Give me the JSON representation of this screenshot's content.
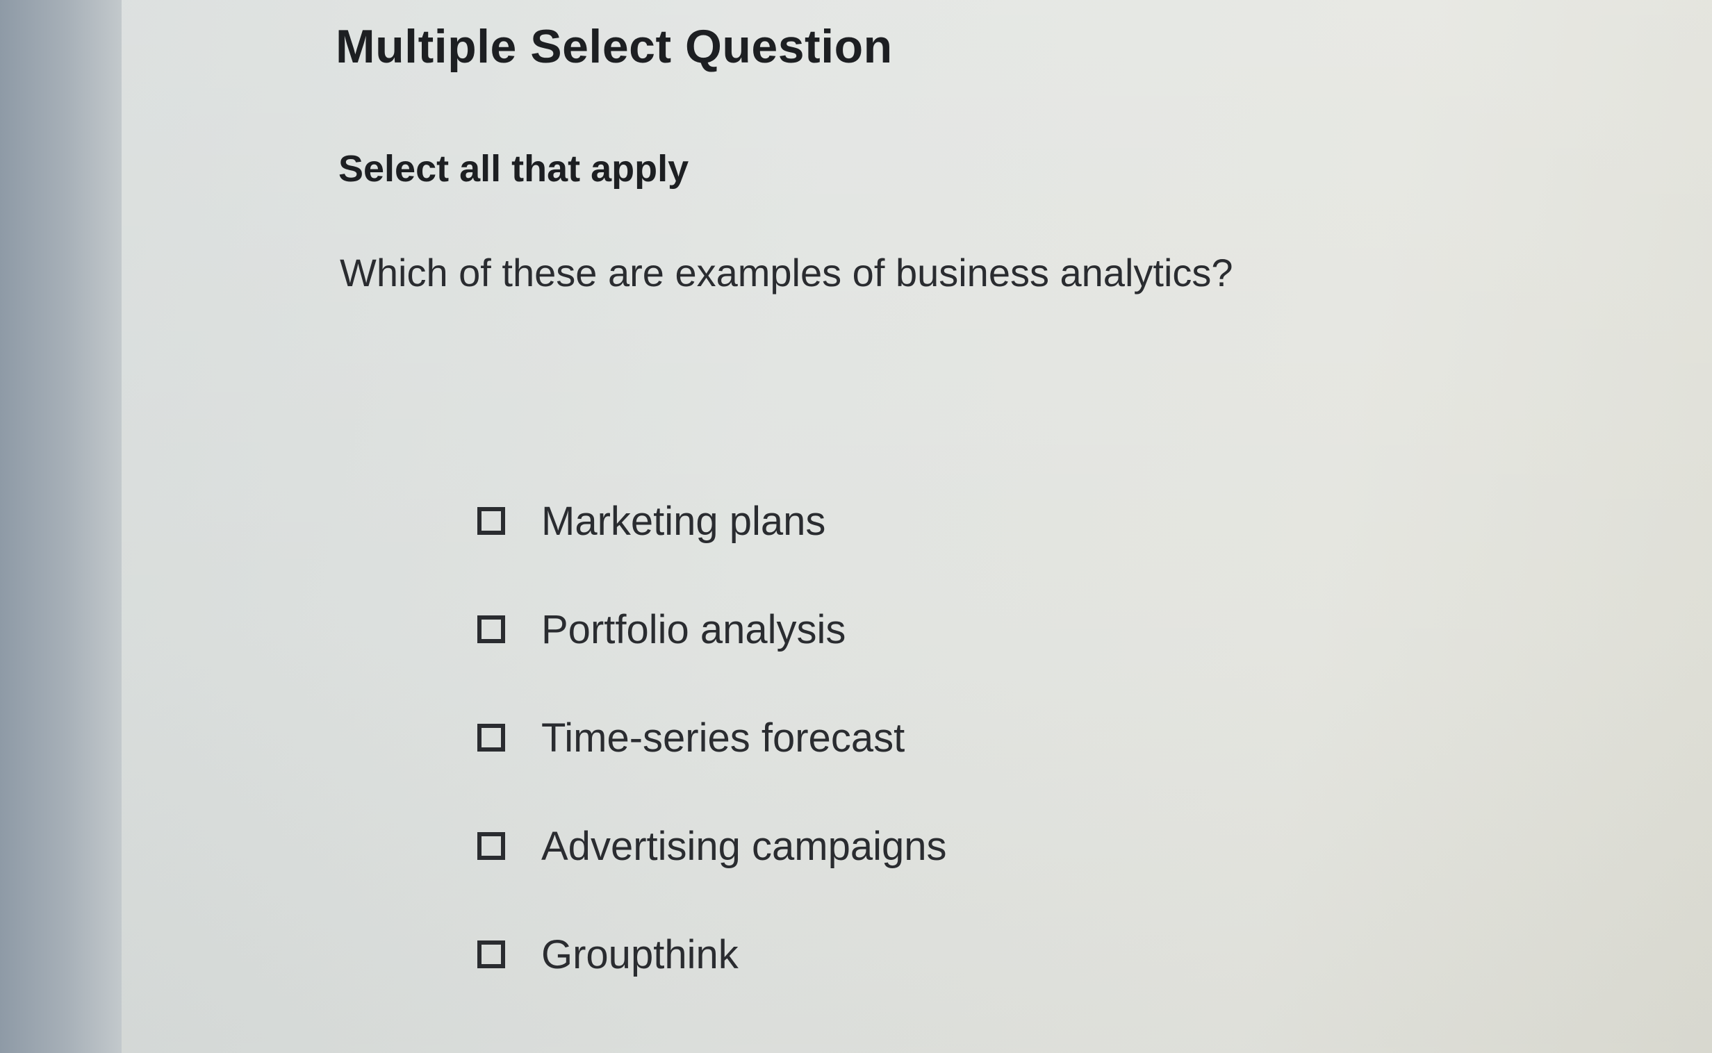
{
  "question": {
    "type_label": "Multiple Select Question",
    "instruction": "Select all that apply",
    "prompt": "Which of these are examples of business analytics?"
  },
  "options": [
    {
      "label": "Marketing plans",
      "checked": false
    },
    {
      "label": "Portfolio analysis",
      "checked": false
    },
    {
      "label": "Time-series forecast",
      "checked": false
    },
    {
      "label": "Advertising campaigns",
      "checked": false
    },
    {
      "label": "Groupthink",
      "checked": false
    }
  ]
}
